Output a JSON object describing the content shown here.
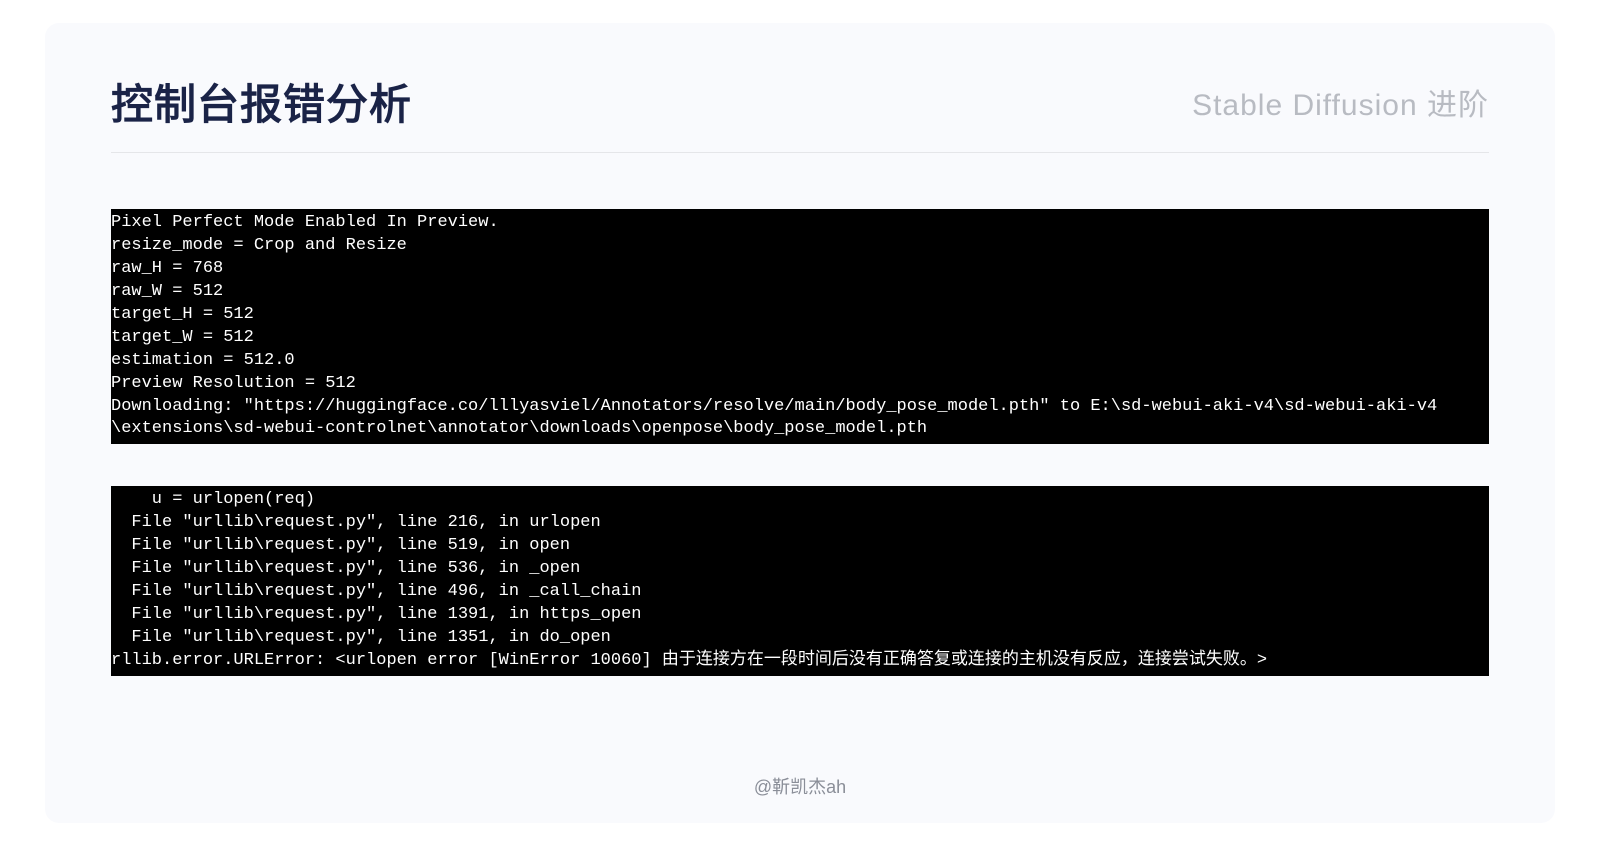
{
  "header": {
    "title": "控制台报错分析",
    "subtitle": "Stable Diffusion 进阶"
  },
  "console1": "Pixel Perfect Mode Enabled In Preview.\nresize_mode = Crop and Resize\nraw_H = 768\nraw_W = 512\ntarget_H = 512\ntarget_W = 512\nestimation = 512.0\nPreview Resolution = 512\nDownloading: \"https://huggingface.co/lllyasviel/Annotators/resolve/main/body_pose_model.pth\" to E:\\sd-webui-aki-v4\\sd-webui-aki-v4\n\\extensions\\sd-webui-controlnet\\annotator\\downloads\\openpose\\body_pose_model.pth\n",
  "console2": "    u = urlopen(req)\n  File \"urllib\\request.py\", line 216, in urlopen\n  File \"urllib\\request.py\", line 519, in open\n  File \"urllib\\request.py\", line 536, in _open\n  File \"urllib\\request.py\", line 496, in _call_chain\n  File \"urllib\\request.py\", line 1391, in https_open\n  File \"urllib\\request.py\", line 1351, in do_open\nrllib.error.URLError: <urlopen error [WinError 10060] 由于连接方在一段时间后没有正确答复或连接的主机没有反应，连接尝试失败。>\n",
  "footer": {
    "credit": "@靳凯杰ah"
  }
}
